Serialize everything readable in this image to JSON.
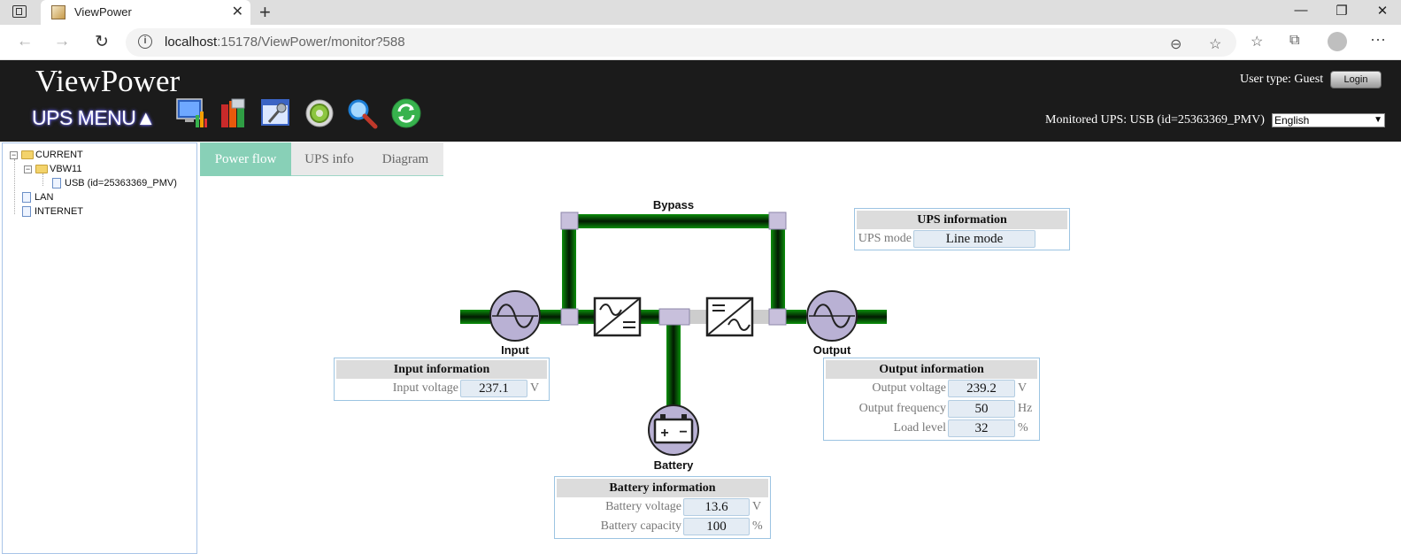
{
  "browser": {
    "tab_title": "ViewPower",
    "url_host": "localhost",
    "url_path": ":15178/ViewPower/monitor?588"
  },
  "header": {
    "app_title": "ViewPower",
    "ups_menu": "UPS MENU▲",
    "user_type": "User type: Guest",
    "login_label": "Login",
    "monitored": "Monitored UPS: USB (id=25363369_PMV)",
    "language": "English"
  },
  "sidebar": {
    "tree": [
      {
        "label": "CURRENT",
        "kind": "folder",
        "expanded": true
      },
      {
        "label": "VBW11",
        "kind": "folder",
        "expanded": true
      },
      {
        "label": "USB (id=25363369_PMV)",
        "kind": "doc"
      },
      {
        "label": "LAN",
        "kind": "doc"
      },
      {
        "label": "INTERNET",
        "kind": "doc"
      }
    ]
  },
  "tabs": [
    {
      "label": "Power flow",
      "active": true
    },
    {
      "label": "UPS info",
      "active": false
    },
    {
      "label": "Diagram",
      "active": false
    }
  ],
  "flow": {
    "bypass_label": "Bypass",
    "input_label": "Input",
    "output_label": "Output",
    "battery_label": "Battery",
    "active_color": "#0a8a0a",
    "node_color": "#b9b1d4"
  },
  "ups_info": {
    "title": "UPS information",
    "mode_label": "UPS mode",
    "mode_value": "Line mode"
  },
  "input_info": {
    "title": "Input information",
    "voltage_label": "Input voltage",
    "voltage_value": "237.1",
    "voltage_unit": "V"
  },
  "output_info": {
    "title": "Output information",
    "voltage_label": "Output voltage",
    "voltage_value": "239.2",
    "voltage_unit": "V",
    "frequency_label": "Output frequency",
    "frequency_value": "50",
    "frequency_unit": "Hz",
    "load_label": "Load level",
    "load_value": "32",
    "load_unit": "%"
  },
  "battery_info": {
    "title": "Battery information",
    "voltage_label": "Battery voltage",
    "voltage_value": "13.6",
    "voltage_unit": "V",
    "capacity_label": "Battery capacity",
    "capacity_value": "100",
    "capacity_unit": "%"
  }
}
